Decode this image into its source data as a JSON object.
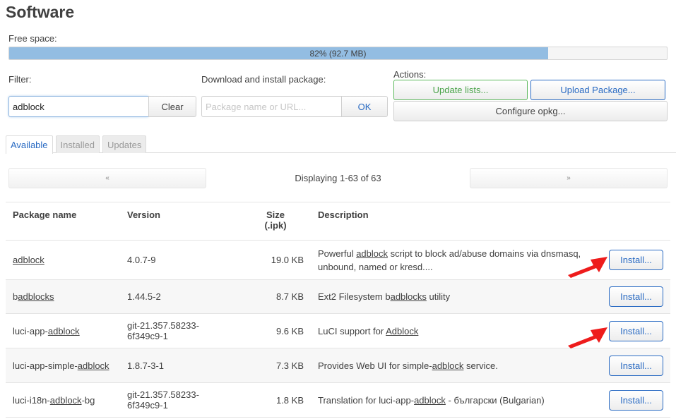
{
  "page": {
    "title": "Software"
  },
  "free_space": {
    "label": "Free space:",
    "percent": 82,
    "text": "82% (92.7 MB)"
  },
  "filter": {
    "label": "Filter:",
    "value": "adblock",
    "clear_label": "Clear"
  },
  "download": {
    "label": "Download and install package:",
    "placeholder": "Package name or URL...",
    "ok_label": "OK"
  },
  "actions": {
    "label": "Actions:",
    "update_lists": "Update lists...",
    "upload_package": "Upload Package...",
    "configure_opkg": "Configure opkg..."
  },
  "tabs": [
    {
      "label": "Available",
      "active": true
    },
    {
      "label": "Installed",
      "active": false
    },
    {
      "label": "Updates",
      "active": false
    }
  ],
  "pager": {
    "prev": "«",
    "next": "»",
    "text": "Displaying 1-63 of 63"
  },
  "table": {
    "headers": {
      "name": "Package name",
      "version": "Version",
      "size_line1": "Size",
      "size_line2": "(.ipk)",
      "description": "Description"
    },
    "install_label": "Install...",
    "rows": [
      {
        "name_pre": "",
        "name_match": "adblock",
        "name_post": "",
        "version": "4.0.7-9",
        "size": "19.0 KB",
        "desc_pre": "Powerful ",
        "desc_match": "adblock",
        "desc_post": " script to block ad/abuse domains via dnsmasq, unbound, named or kresd....",
        "highlighted": true
      },
      {
        "name_pre": "b",
        "name_match": "adblocks",
        "name_post": "",
        "version": "1.44.5-2",
        "size": "8.7 KB",
        "desc_pre": "Ext2 Filesystem b",
        "desc_match": "adblocks",
        "desc_post": " utility",
        "highlighted": false
      },
      {
        "name_pre": "luci-app-",
        "name_match": "adblock",
        "name_post": "",
        "version": "git-21.357.58233-6f349c9-1",
        "size": "9.6 KB",
        "desc_pre": "LuCI support for ",
        "desc_match": "Adblock",
        "desc_post": "",
        "highlighted": true
      },
      {
        "name_pre": "luci-app-simple-",
        "name_match": "adblock",
        "name_post": "",
        "version": "1.8.7-3-1",
        "size": "7.3 KB",
        "desc_pre": "Provides Web UI for simple-",
        "desc_match": "adblock",
        "desc_post": " service.",
        "highlighted": false
      },
      {
        "name_pre": "luci-i18n-",
        "name_match": "adblock",
        "name_post": "-bg",
        "version": "git-21.357.58233-6f349c9-1",
        "size": "1.8 KB",
        "desc_pre": "Translation for luci-app-",
        "desc_match": "adblock",
        "desc_post": " - български (Bulgarian)",
        "highlighted": false
      }
    ]
  },
  "colors": {
    "accent_blue": "#2a6bc3",
    "positive_green": "#4aa34a",
    "progress_fill": "#93bde2",
    "annotation_arrow": "#ee1c1c"
  }
}
